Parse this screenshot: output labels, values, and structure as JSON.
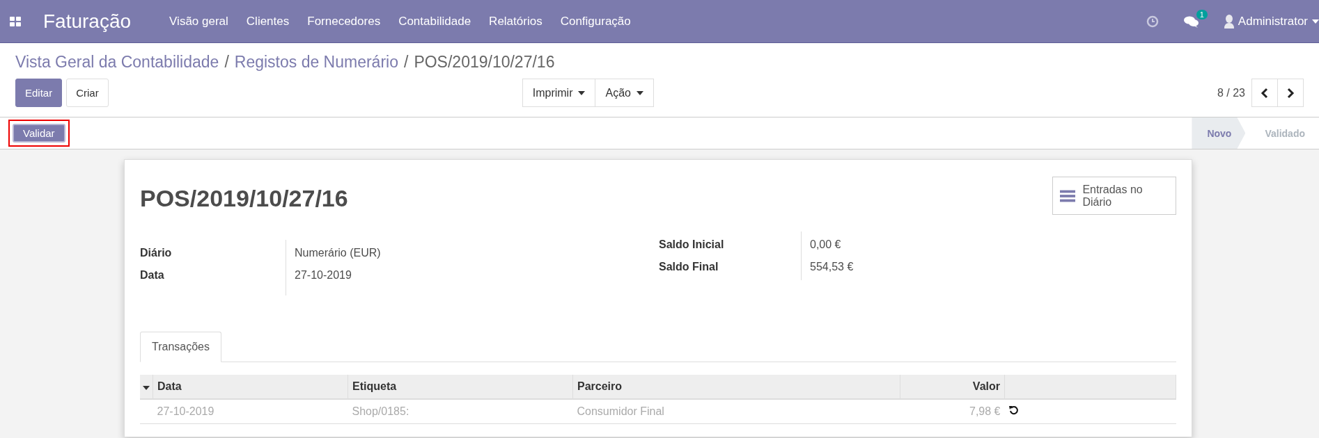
{
  "app": {
    "title": "Faturação"
  },
  "menu": [
    {
      "label": "Visão geral"
    },
    {
      "label": "Clientes"
    },
    {
      "label": "Fornecedores"
    },
    {
      "label": "Contabilidade"
    },
    {
      "label": "Relatórios"
    },
    {
      "label": "Configuração"
    }
  ],
  "systray": {
    "messages_badge": "1",
    "user": "Administrator"
  },
  "breadcrumb_separator": "/",
  "breadcrumbs": [
    {
      "label": "Vista Geral da Contabilidade",
      "kind": "link"
    },
    {
      "label": "Registos de Numerário",
      "kind": "link"
    },
    {
      "label": "POS/2019/10/27/16",
      "kind": "current"
    }
  ],
  "buttons": [
    {
      "label": "Editar",
      "kind": "primary"
    },
    {
      "label": "Criar",
      "kind": "secondary"
    }
  ],
  "dropdowns": [
    {
      "label": "Imprimir"
    },
    {
      "label": "Ação"
    }
  ],
  "pager": {
    "value": "8 / 23"
  },
  "status_actions": [
    {
      "label": "Validar",
      "highlighted": true
    }
  ],
  "status_steps": [
    {
      "label": "Novo",
      "selected": true
    },
    {
      "label": "Validado",
      "selected": false
    }
  ],
  "record": {
    "title": "POS/2019/10/27/16",
    "smart_button": "Entradas no Diário",
    "left_fields": [
      {
        "label": "Diário",
        "value": "Numerário (EUR)"
      },
      {
        "label": "Data",
        "value": "27-10-2019"
      }
    ],
    "right_fields": [
      {
        "label": "Saldo Inicial",
        "value": "0,00 €"
      },
      {
        "label": "Saldo Final",
        "value": "554,53 €"
      }
    ]
  },
  "tabs": [
    {
      "label": "Transações",
      "selected": true
    }
  ],
  "table": {
    "columns": [
      "Data",
      "Etiqueta",
      "Parceiro",
      "Valor"
    ],
    "rows": [
      {
        "cells": [
          "27-10-2019",
          "Shop/0185:",
          "Consumidor Final",
          "7,98 €"
        ]
      }
    ]
  }
}
